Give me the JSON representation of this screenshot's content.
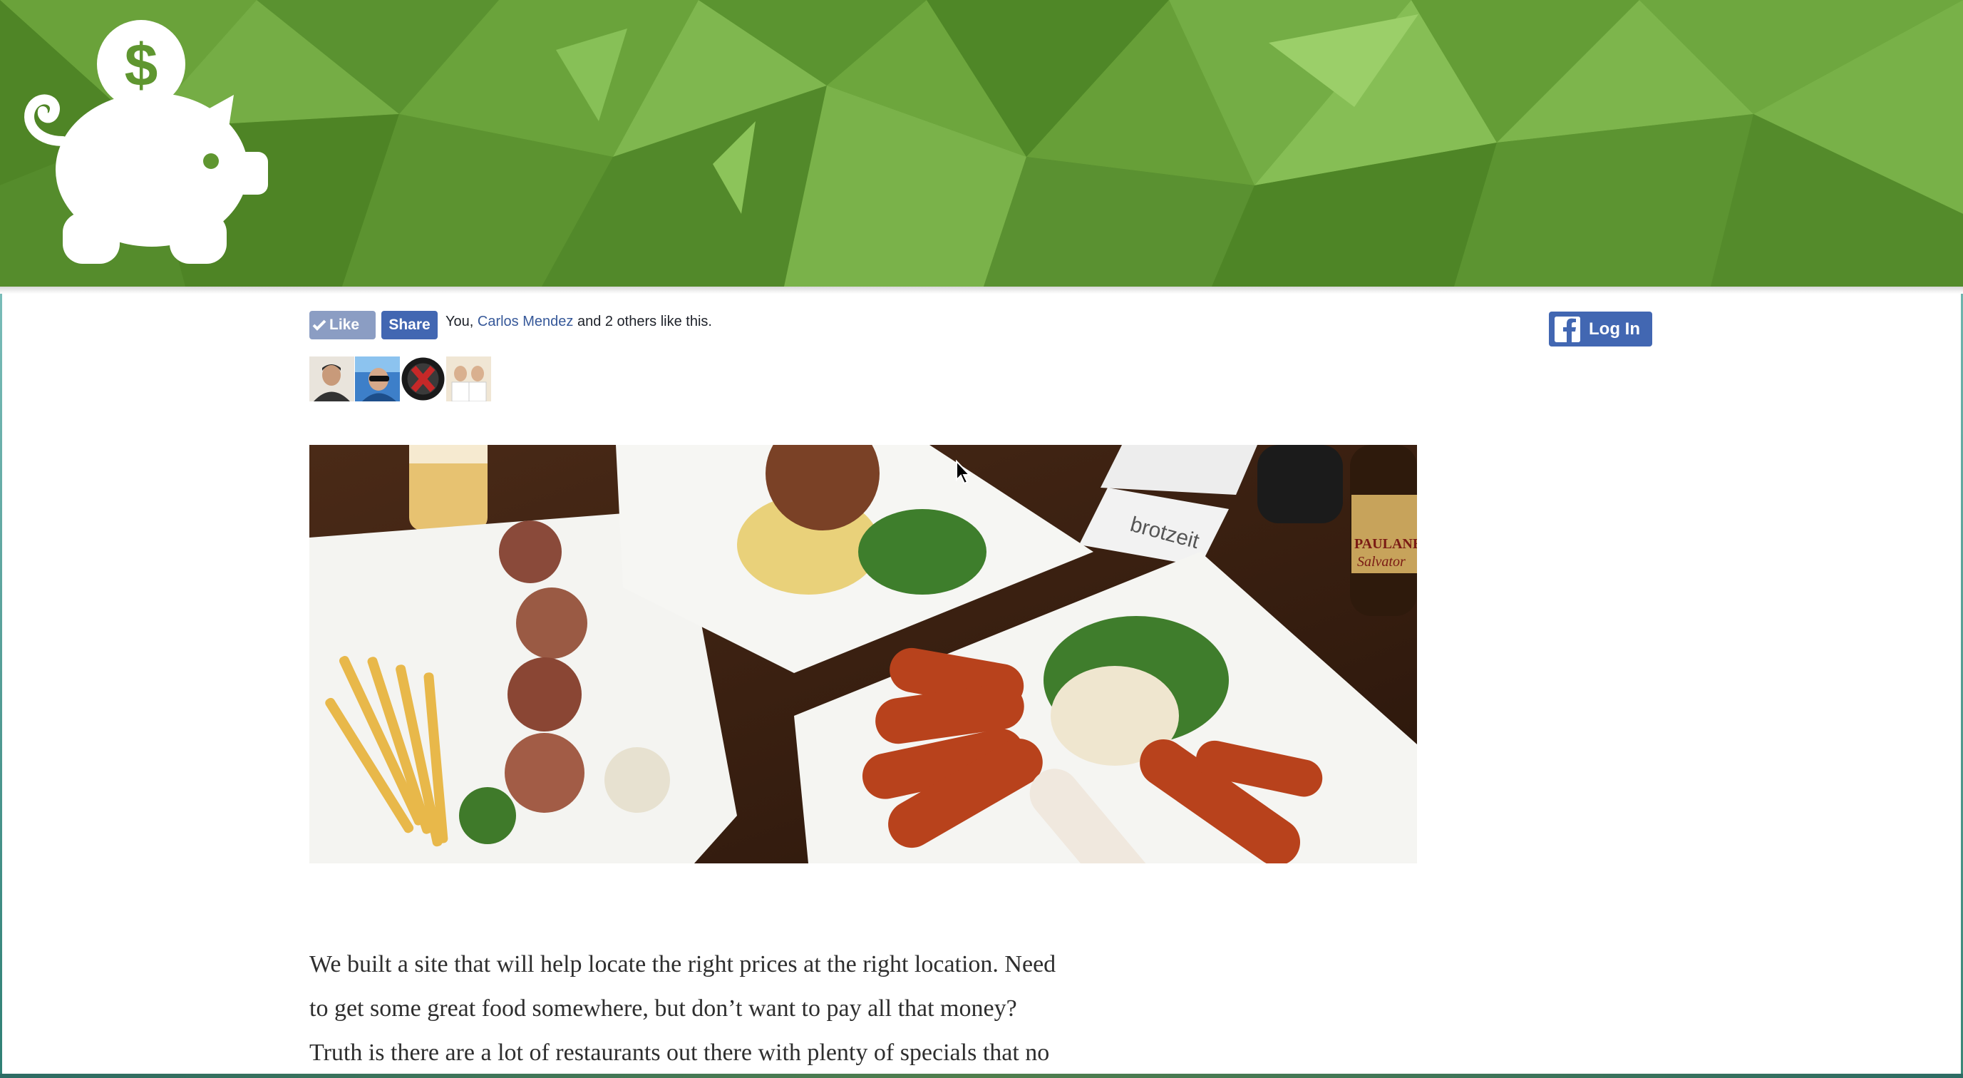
{
  "header": {
    "logo_icon": "piggy-bank-dollar-icon",
    "background_color": "#5f9630"
  },
  "social": {
    "like_label": "Like",
    "share_label": "Share",
    "likes_prefix": "You, ",
    "likes_name": "Carlos Mendez",
    "likes_suffix": " and 2 others like this.",
    "avatars": [
      "avatar-1",
      "avatar-2",
      "avatar-3",
      "avatar-4"
    ]
  },
  "login": {
    "label": "Log In",
    "icon": "facebook-icon"
  },
  "hero": {
    "brand_text": "brotzeit",
    "beer_label_1": "PAULANER",
    "beer_label_2": "Salvator"
  },
  "intro": {
    "line1": "We built a site that will help locate the right prices at the right location. Need",
    "line2": "to get some great food somewhere, but don’t want to pay all that money?",
    "line3": "Truth is there are a lot of restaurants out there with plenty of specials that no"
  }
}
